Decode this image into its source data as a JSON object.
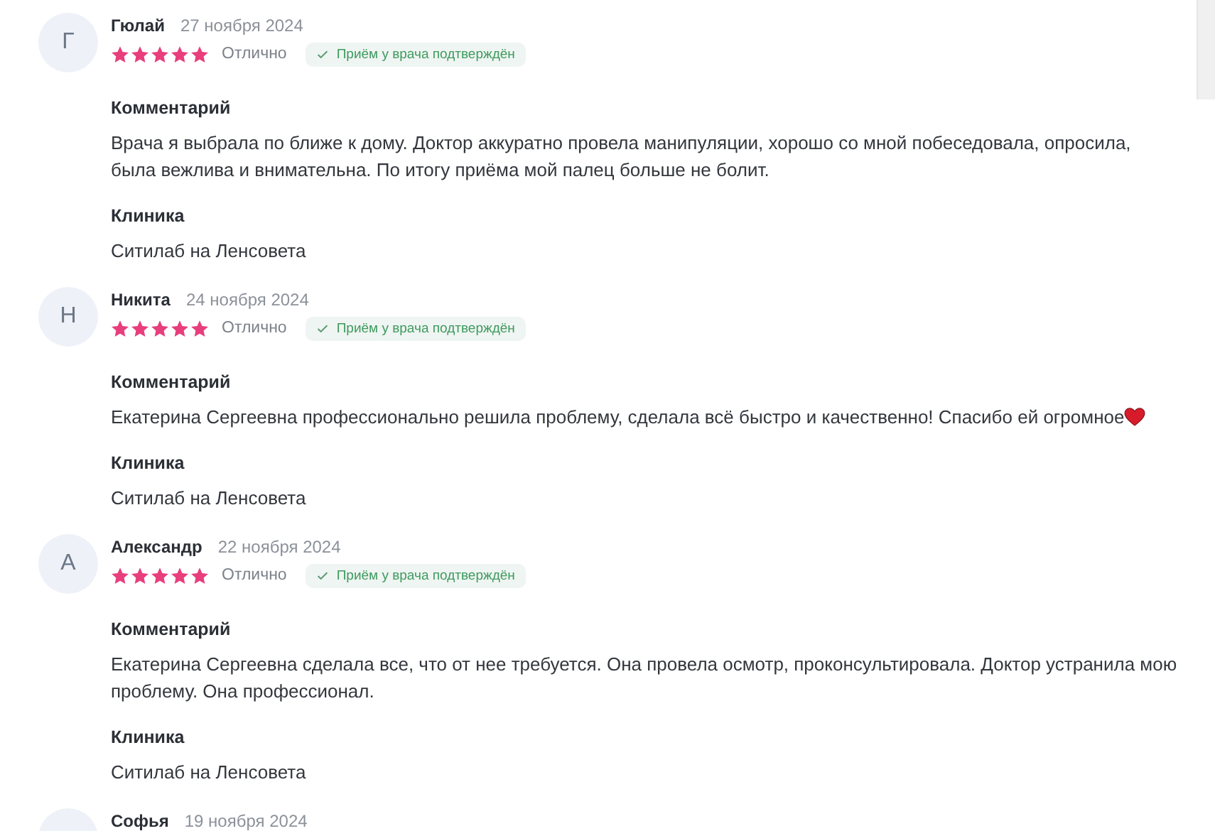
{
  "reviews": [
    {
      "avatar_letter": "Г",
      "name": "Гюлай",
      "date": "27 ноября 2024",
      "stars": 5,
      "rating_label": "Отлично",
      "badge": "Приём у врача подтверждён",
      "comment_heading": "Комментарий",
      "comment": "Врача я выбрала по ближе к дому. Доктор аккуратно провела манипуляции, хорошо со мной побеседовала, опросила, была вежлива и внимательна. По итогу приёма мой палец больше не болит.",
      "clinic_heading": "Клиника",
      "clinic": "Ситилаб на Ленсовета"
    },
    {
      "avatar_letter": "Н",
      "name": "Никита",
      "date": "24 ноября 2024",
      "stars": 5,
      "rating_label": "Отлично",
      "badge": "Приём у врача подтверждён",
      "comment_heading": "Комментарий",
      "comment": "Екатерина Сергеевна профессионально решила проблему, сделала всё быстро и качественно! Спасибо ей огромное",
      "comment_heart": true,
      "clinic_heading": "Клиника",
      "clinic": "Ситилаб на Ленсовета"
    },
    {
      "avatar_letter": "А",
      "name": "Александр",
      "date": "22 ноября 2024",
      "stars": 5,
      "rating_label": "Отлично",
      "badge": "Приём у врача подтверждён",
      "comment_heading": "Комментарий",
      "comment": "Екатерина Сергеевна сделала все, что от нее требуется. Она провела осмотр, проконсультировала. Доктор устранила мою проблему. Она профессионал.",
      "clinic_heading": "Клиника",
      "clinic": "Ситилаб на Ленсовета"
    },
    {
      "name": "Софья",
      "date": "19 ноября 2024"
    }
  ]
}
